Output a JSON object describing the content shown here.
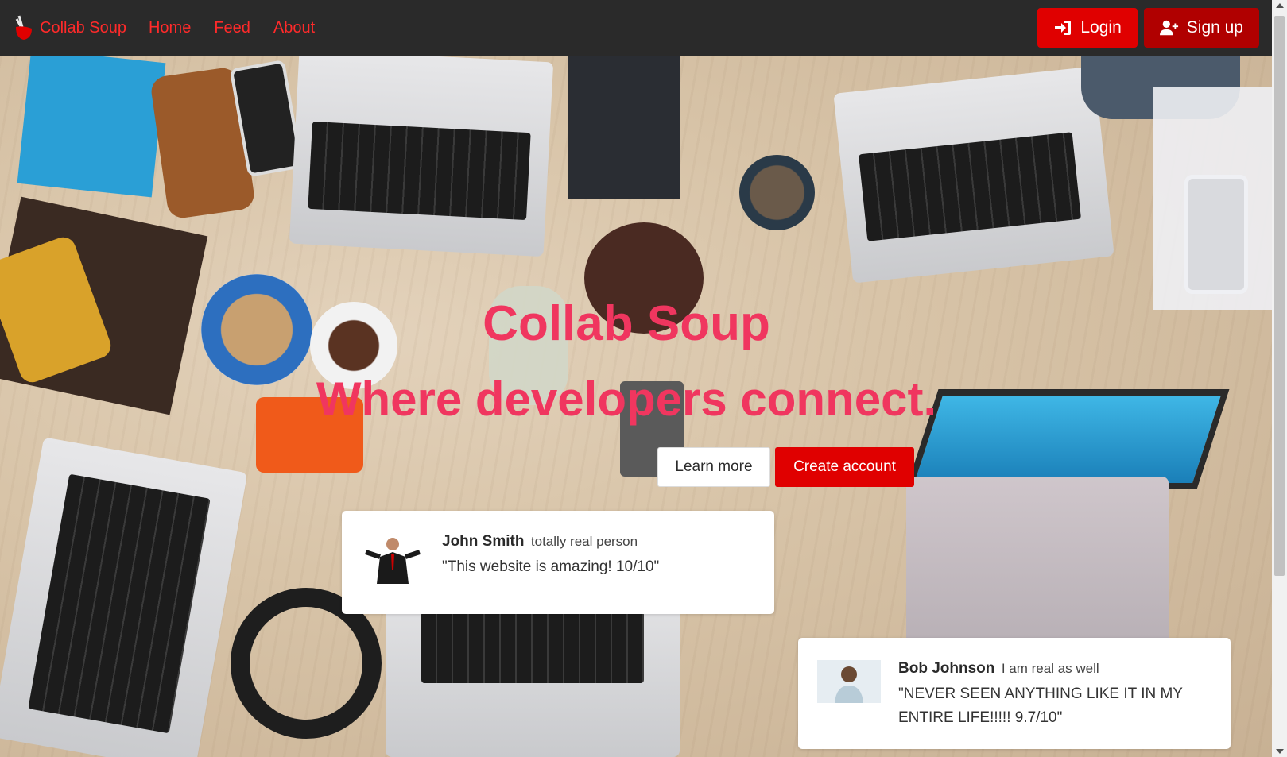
{
  "nav": {
    "brand": "Collab Soup",
    "links": [
      "Home",
      "Feed",
      "About"
    ],
    "login_label": "Login",
    "signup_label": "Sign up"
  },
  "hero": {
    "title": "Collab Soup",
    "subtitle": "Where developers connect.",
    "learn_more_label": "Learn more",
    "create_account_label": "Create account"
  },
  "testimonials": [
    {
      "name": "John Smith",
      "role": "totally real person",
      "quote": "\"This website is amazing! 10/10\""
    },
    {
      "name": "Bob Johnson",
      "role": "I am real as well",
      "quote": "\"NEVER SEEN ANYTHING LIKE IT IN MY ENTIRE LIFE!!!!! 9.7/10\""
    }
  ],
  "colors": {
    "accent": "#e00000",
    "title": "#f0365f",
    "navbar": "#2a2a2a"
  }
}
